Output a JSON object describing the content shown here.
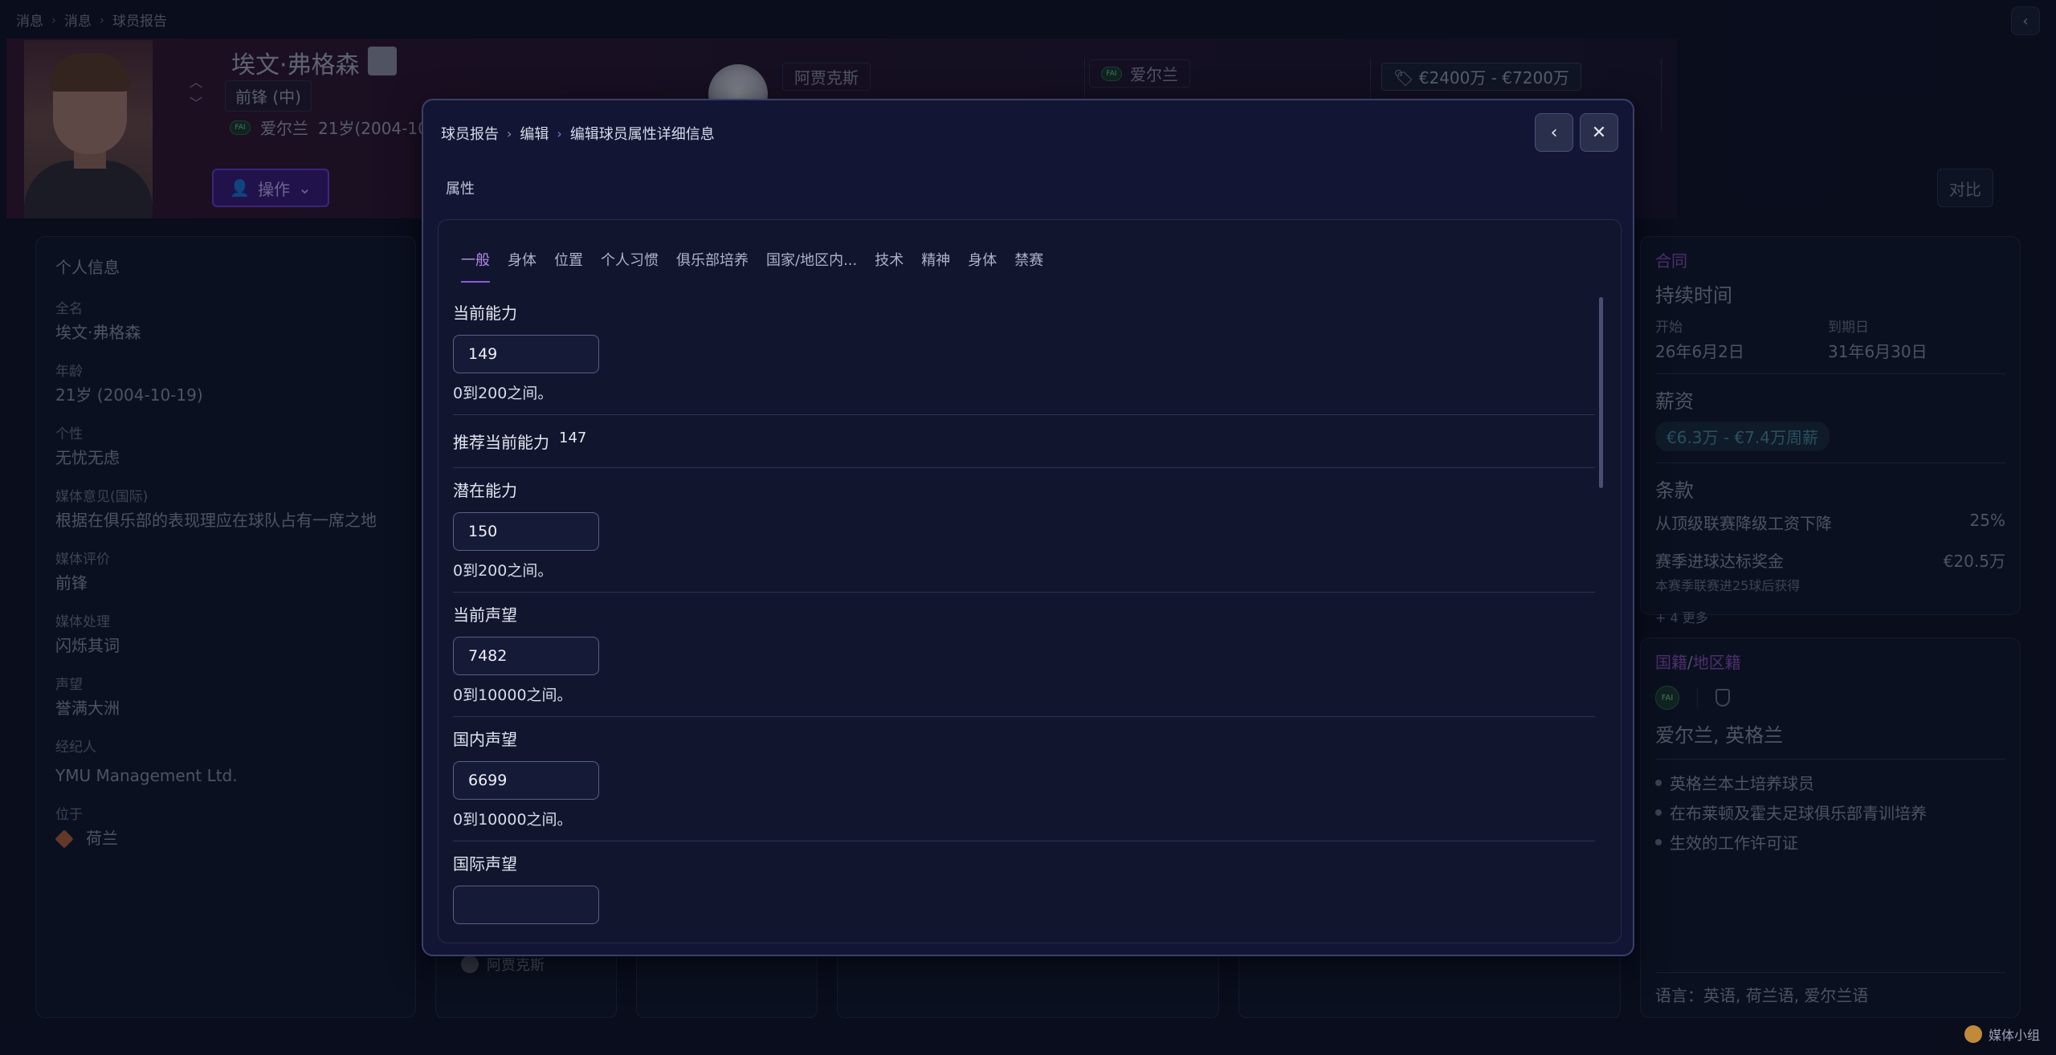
{
  "top_breadcrumb": [
    "消息",
    "消息",
    "球员报告"
  ],
  "player": {
    "name": "埃文·弗格森",
    "position": "前锋 (中)",
    "nationality": "爱尔兰",
    "age_short": "21岁(2004-10",
    "action_label": "操作",
    "club": "阿贾克斯",
    "nation_chip": "爱尔兰",
    "value": "€2400万 - €7200万",
    "compare_label": "对比"
  },
  "personal_info": {
    "title": "个人信息",
    "items": [
      {
        "label": "全名",
        "value": "埃文·弗格森"
      },
      {
        "label": "年龄",
        "value": "21岁 (2004-10-19)"
      },
      {
        "label": "个性",
        "value": "无忧无虑"
      },
      {
        "label": "媒体意见(国际)",
        "value": "根据在俱乐部的表现理应在球队占有一席之地"
      },
      {
        "label": "媒体评价",
        "value": "前锋"
      },
      {
        "label": "媒体处理",
        "value": "闪烁其词"
      },
      {
        "label": "声望",
        "value": "誉满大洲"
      },
      {
        "label": "经纪人",
        "value": "YMU Management Ltd."
      }
    ],
    "location_label": "位于",
    "location_value": "荷兰"
  },
  "contract": {
    "header": "合同",
    "duration_title": "持续时间",
    "start_label": "开始",
    "start_value": "26年6月2日",
    "end_label": "到期日",
    "end_value": "31年6月30日",
    "wage_title": "薪资",
    "wage_value": "€6.3万 - €7.4万周薪",
    "clauses_title": "条款",
    "clause1_label": "从顶级联赛降级工资下降",
    "clause1_value": "25%",
    "clause2_label": "赛季进球达标奖金",
    "clause2_value": "€20.5万",
    "clause2_sub": "本赛季联赛进25球后获得",
    "more": "+ 4  更多"
  },
  "nationality_panel": {
    "header_a": "国籍",
    "header_sep": "/",
    "header_b": "地区籍",
    "fai": "FAI",
    "countries": "爱尔兰, 英格兰",
    "bullets": [
      "英格兰本土培养球员",
      "在布莱顿及霍夫足球俱乐部青训培养",
      "生效的工作许可证"
    ],
    "languages": "语言：英语, 荷兰语, 爱尔兰语"
  },
  "mini_card": {
    "club": "阿贾克斯"
  },
  "modal": {
    "breadcrumb": [
      "球员报告",
      "编辑",
      "编辑球员属性详细信息"
    ],
    "section_label": "属性",
    "tabs": [
      "一般",
      "身体",
      "位置",
      "个人习惯",
      "俱乐部培养",
      "国家/地区内...",
      "技术",
      "精神",
      "身体",
      "禁赛"
    ],
    "current_ability": {
      "title": "当前能力",
      "value": "149",
      "hint": "0到200之间。"
    },
    "recommended": {
      "title": "推荐当前能力",
      "value": "147"
    },
    "potential": {
      "title": "潜在能力",
      "value": "150",
      "hint": "0到200之间。"
    },
    "current_rep": {
      "title": "当前声望",
      "value": "7482",
      "hint": "0到10000之间。"
    },
    "home_rep": {
      "title": "国内声望",
      "value": "6699",
      "hint": "0到10000之间。"
    },
    "world_rep": {
      "title": "国际声望"
    }
  },
  "watermark": "媒体小组"
}
